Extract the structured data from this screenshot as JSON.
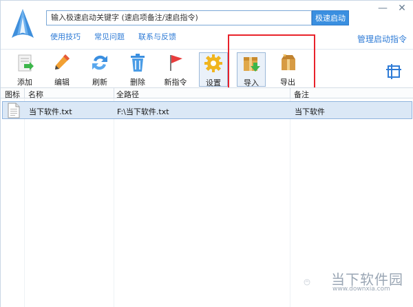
{
  "header": {
    "search_placeholder": "输入极速启动关键字 (速启项备注/速启指令)",
    "go_button": "极速启动",
    "links": [
      "使用技巧",
      "常见问题",
      "联系与反馈"
    ],
    "manage_link": "管理启动指令",
    "window_controls": [
      "—",
      "✕"
    ]
  },
  "toolbar": {
    "items": [
      {
        "label": "添加",
        "icon": "add-icon"
      },
      {
        "label": "编辑",
        "icon": "edit-pencil-icon"
      },
      {
        "label": "刷新",
        "icon": "refresh-icon"
      },
      {
        "label": "删除",
        "icon": "trash-icon"
      },
      {
        "label": "新指令",
        "icon": "new-command-flag-icon"
      },
      {
        "label": "设置",
        "icon": "gear-icon"
      },
      {
        "label": "导入",
        "icon": "import-box-icon"
      },
      {
        "label": "导出",
        "icon": "export-box-icon"
      }
    ],
    "right_icon": "layout-icon"
  },
  "table": {
    "columns": [
      "图标",
      "名称",
      "全路径",
      "备注"
    ],
    "rows": [
      {
        "name": "当下软件.txt",
        "path": "F:\\当下软件.txt",
        "note": "当下软件"
      }
    ]
  },
  "watermark": {
    "text": "当下软件园",
    "url": "www.downxia.com"
  },
  "colors": {
    "accent": "#3a8fe0",
    "link": "#2e7bd6",
    "highlight": "#e8212a",
    "row_selected": "#dbe8f6"
  }
}
